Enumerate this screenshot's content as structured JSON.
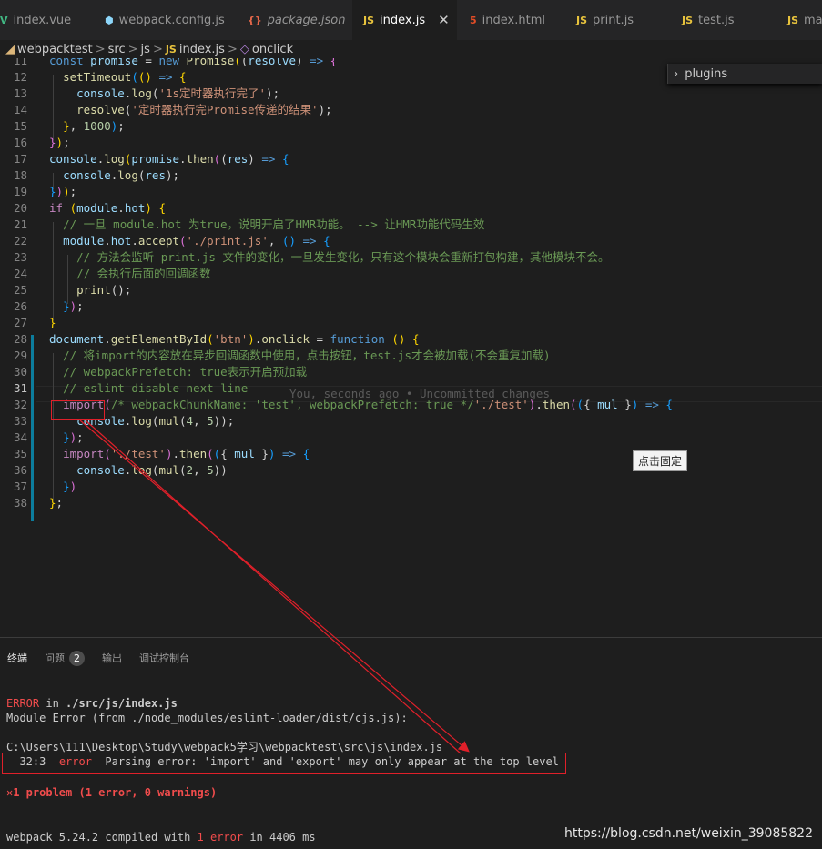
{
  "tabs": [
    {
      "icon": "V",
      "label": "index.vue"
    },
    {
      "icon": "⬢",
      "label": "webpack.config.js"
    },
    {
      "icon": "{}",
      "label": "package.json"
    },
    {
      "icon": "JS",
      "label": "index.js",
      "close": "✕"
    },
    {
      "icon": "5",
      "label": "index.html"
    },
    {
      "icon": "JS",
      "label": "print.js"
    },
    {
      "icon": "JS",
      "label": "test.js"
    },
    {
      "icon": "JS",
      "label": "mai"
    }
  ],
  "breadcrumb": {
    "items": [
      "webpacktest",
      "src",
      "js",
      "index.js",
      "onclick"
    ],
    "file_icon": "JS",
    "separator": ">"
  },
  "outline": {
    "label": "plugins",
    "chevron": "›"
  },
  "editor": {
    "line_numbers": [
      "11",
      "12",
      "13",
      "14",
      "15",
      "16",
      "17",
      "18",
      "19",
      "20",
      "21",
      "22",
      "23",
      "24",
      "25",
      "26",
      "27",
      "28",
      "29",
      "30",
      "31",
      "32",
      "33",
      "34",
      "35",
      "36",
      "37",
      "38"
    ],
    "blame": "You, seconds ago • Uncommitted changes",
    "tooltip": "点击固定"
  },
  "panel": {
    "tabs": [
      {
        "label": "终端"
      },
      {
        "label": "问题",
        "badge": "2"
      },
      {
        "label": "输出"
      },
      {
        "label": "调试控制台"
      }
    ],
    "error_word": "ERROR",
    "error_in": " in ",
    "error_file": "./src/js/index.js",
    "module_error": "Module Error (from ./node_modules/eslint-loader/dist/cjs.js):",
    "path": "C:\\Users\\111\\Desktop\\Study\\webpack5学习\\webpacktest\\src\\js\\index.js",
    "loc": "  32:3",
    "err_label": "error",
    "err_message": "Parsing error: 'import' and 'export' may only appear at the top level",
    "problem_icon": "✕",
    "problem_text": "1 problem (1 error, 0 warnings)",
    "compiled_prefix": "webpack 5.24.2 compiled with ",
    "compiled_error": "1 error",
    "compiled_suffix": " in 4406 ms"
  },
  "watermark": "https://blog.csdn.net/weixin_39085822"
}
